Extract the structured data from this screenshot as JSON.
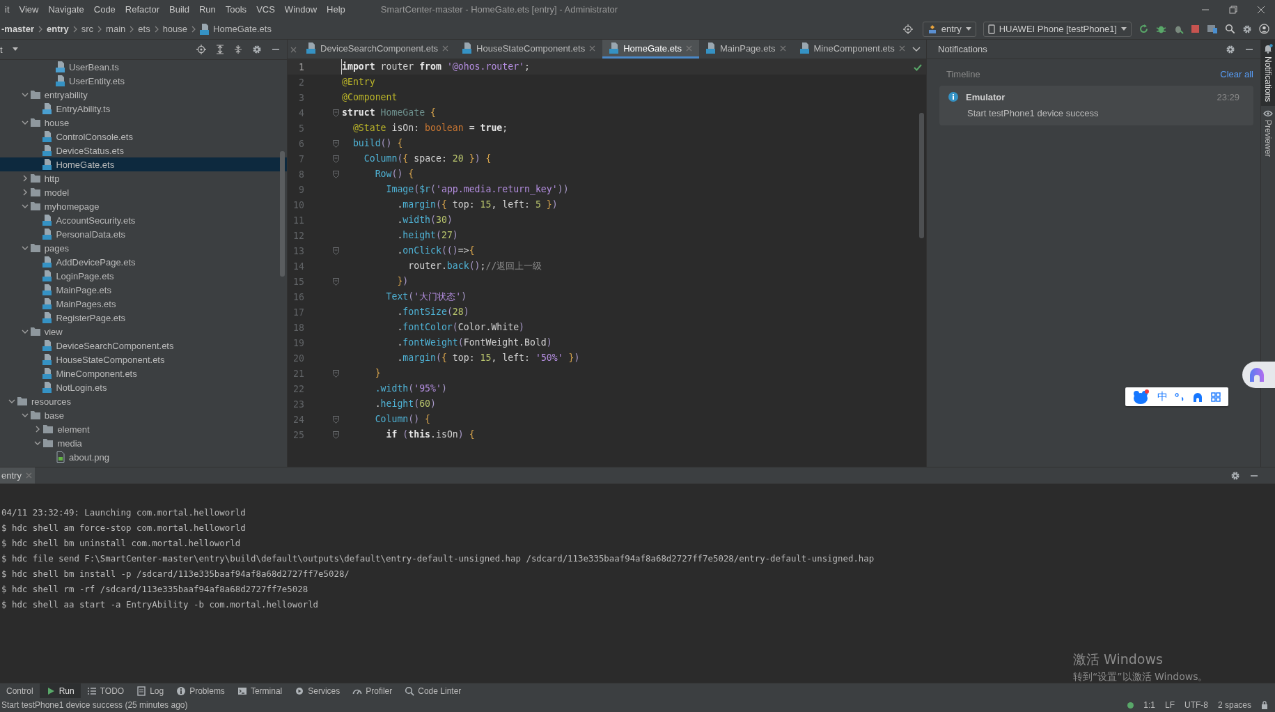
{
  "menu_bar": {
    "items": [
      "it",
      "View",
      "Navigate",
      "Code",
      "Refactor",
      "Build",
      "Run",
      "Tools",
      "VCS",
      "Window",
      "Help"
    ],
    "title": "SmartCenter-master - HomeGate.ets [entry] - Administrator"
  },
  "nav_bar": {
    "breadcrumb": [
      {
        "label": "-master",
        "bold": true
      },
      {
        "label": "entry",
        "bold": true
      },
      {
        "label": "src",
        "bold": false
      },
      {
        "label": "main",
        "bold": false
      },
      {
        "label": "ets",
        "bold": false
      },
      {
        "label": "house",
        "bold": false
      },
      {
        "label": "HomeGate.ets",
        "bold": false
      }
    ],
    "module_selector": "entry",
    "device_selector": "HUAWEI Phone [testPhone1]"
  },
  "project": {
    "header": "t",
    "tree": [
      {
        "kind": "offscreen",
        "children": [
          {
            "kind": "offscreen",
            "children": [
              {
                "kind": "offscreen",
                "children": [
                  {
                    "kind": "ts",
                    "name": "UserBean.ts",
                    "selected": false
                  },
                  {
                    "kind": "ets",
                    "name": "UserEntity.ets",
                    "selected": false
                  }
                ]
              }
            ]
          },
          {
            "kind": "folder",
            "name": "entryability",
            "expanded": true,
            "selected": false,
            "children": [
              {
                "kind": "ts",
                "name": "EntryAbility.ts",
                "selected": false
              }
            ]
          },
          {
            "kind": "folder",
            "name": "house",
            "expanded": true,
            "selected": false,
            "children": [
              {
                "kind": "ets",
                "name": "ControlConsole.ets",
                "selected": false
              },
              {
                "kind": "ets",
                "name": "DeviceStatus.ets",
                "selected": false
              },
              {
                "kind": "ets",
                "name": "HomeGate.ets",
                "selected": true
              }
            ]
          },
          {
            "kind": "folder",
            "name": "http",
            "expanded": false,
            "selected": false
          },
          {
            "kind": "folder",
            "name": "model",
            "expanded": false,
            "selected": false
          },
          {
            "kind": "folder",
            "name": "myhomepage",
            "expanded": true,
            "selected": false,
            "children": [
              {
                "kind": "ets",
                "name": "AccountSecurity.ets",
                "selected": false
              },
              {
                "kind": "ets",
                "name": "PersonalData.ets",
                "selected": false
              }
            ]
          },
          {
            "kind": "folder",
            "name": "pages",
            "expanded": true,
            "selected": false,
            "children": [
              {
                "kind": "ets",
                "name": "AddDevicePage.ets",
                "selected": false
              },
              {
                "kind": "ets",
                "name": "LoginPage.ets",
                "selected": false
              },
              {
                "kind": "ets",
                "name": "MainPage.ets",
                "selected": false
              },
              {
                "kind": "ets",
                "name": "MainPages.ets",
                "selected": false
              },
              {
                "kind": "ets",
                "name": "RegisterPage.ets",
                "selected": false
              }
            ]
          },
          {
            "kind": "folder",
            "name": "view",
            "expanded": true,
            "selected": false,
            "children": [
              {
                "kind": "ets",
                "name": "DeviceSearchComponent.ets",
                "selected": false
              },
              {
                "kind": "ets",
                "name": "HouseStateComponent.ets",
                "selected": false
              },
              {
                "kind": "ets",
                "name": "MineComponent.ets",
                "selected": false
              },
              {
                "kind": "ets",
                "name": "NotLogin.ets",
                "selected": false
              }
            ]
          }
        ]
      },
      {
        "kind": "folder",
        "name": "resources",
        "expanded": true,
        "selected": false,
        "children": [
          {
            "kind": "folder",
            "name": "base",
            "expanded": true,
            "selected": false,
            "children": [
              {
                "kind": "folder",
                "name": "element",
                "expanded": false,
                "selected": false
              },
              {
                "kind": "folder",
                "name": "media",
                "expanded": true,
                "selected": false,
                "children": [
                  {
                    "kind": "png",
                    "name": "about.png",
                    "selected": false
                  }
                ]
              }
            ]
          }
        ]
      }
    ]
  },
  "editor": {
    "tabs": [
      {
        "label": "DeviceSearchComponent.ets",
        "selected": false
      },
      {
        "label": "HouseStateComponent.ets",
        "selected": false
      },
      {
        "label": "HomeGate.ets",
        "selected": true
      },
      {
        "label": "MainPage.ets",
        "selected": false
      },
      {
        "label": "MineComponent.ets",
        "selected": false
      }
    ],
    "lines": [
      {
        "number": "1",
        "current": true,
        "fold": false,
        "tokens": [
          {
            "kind": "kw",
            "text": "import"
          },
          {
            "kind": "plain",
            "text": " router "
          },
          {
            "kind": "kw",
            "text": "from"
          },
          {
            "kind": "str",
            "text": " '@ohos.router'"
          },
          {
            "kind": "plain",
            "text": ";"
          }
        ]
      },
      {
        "number": "2",
        "current": false,
        "fold": false,
        "tokens": [
          {
            "kind": "ann",
            "text": "@Entry"
          }
        ]
      },
      {
        "number": "3",
        "current": false,
        "fold": false,
        "tokens": [
          {
            "kind": "ann",
            "text": "@Component"
          }
        ]
      },
      {
        "number": "4",
        "current": false,
        "fold": true,
        "tokens": [
          {
            "kind": "kw",
            "text": "struct"
          },
          {
            "kind": "cls",
            "text": " HomeGate"
          },
          {
            "kind": "brace",
            "text": " {"
          }
        ]
      },
      {
        "number": "5",
        "current": false,
        "fold": false,
        "tokens": [
          {
            "kind": "ann",
            "text": "  @State"
          },
          {
            "kind": "plain",
            "text": " isOn: "
          },
          {
            "kind": "type",
            "text": "boolean"
          },
          {
            "kind": "plain",
            "text": " = "
          },
          {
            "kind": "kw",
            "text": "true"
          },
          {
            "kind": "plain",
            "text": ";"
          }
        ]
      },
      {
        "number": "6",
        "current": false,
        "fold": true,
        "tokens": [
          {
            "kind": "fn",
            "text": "  build"
          },
          {
            "kind": "paren",
            "text": "()"
          },
          {
            "kind": "brace",
            "text": " {"
          }
        ]
      },
      {
        "number": "7",
        "current": false,
        "fold": true,
        "tokens": [
          {
            "kind": "fn",
            "text": "    Column"
          },
          {
            "kind": "paren",
            "text": "("
          },
          {
            "kind": "brace",
            "text": "{"
          },
          {
            "kind": "plain",
            "text": " space: "
          },
          {
            "kind": "num",
            "text": "20"
          },
          {
            "kind": "brace",
            "text": " }"
          },
          {
            "kind": "paren",
            "text": ")"
          },
          {
            "kind": "brace",
            "text": " {"
          }
        ]
      },
      {
        "number": "8",
        "current": false,
        "fold": true,
        "tokens": [
          {
            "kind": "fn",
            "text": "      Row"
          },
          {
            "kind": "paren",
            "text": "()"
          },
          {
            "kind": "brace",
            "text": " {"
          }
        ]
      },
      {
        "number": "9",
        "current": false,
        "fold": false,
        "tokens": [
          {
            "kind": "fn",
            "text": "        Image"
          },
          {
            "kind": "paren",
            "text": "("
          },
          {
            "kind": "fn",
            "text": "$r"
          },
          {
            "kind": "paren",
            "text": "("
          },
          {
            "kind": "str",
            "text": "'app.media.return_key'"
          },
          {
            "kind": "paren",
            "text": "))"
          }
        ]
      },
      {
        "number": "10",
        "current": false,
        "fold": false,
        "tokens": [
          {
            "kind": "plain",
            "text": "          ."
          },
          {
            "kind": "fn",
            "text": "margin"
          },
          {
            "kind": "paren",
            "text": "("
          },
          {
            "kind": "brace",
            "text": "{"
          },
          {
            "kind": "plain",
            "text": " top: "
          },
          {
            "kind": "num",
            "text": "15"
          },
          {
            "kind": "plain",
            "text": ", left: "
          },
          {
            "kind": "num",
            "text": "5"
          },
          {
            "kind": "brace",
            "text": " }"
          },
          {
            "kind": "paren",
            "text": ")"
          }
        ]
      },
      {
        "number": "11",
        "current": false,
        "fold": false,
        "tokens": [
          {
            "kind": "plain",
            "text": "          ."
          },
          {
            "kind": "fn",
            "text": "width"
          },
          {
            "kind": "paren",
            "text": "("
          },
          {
            "kind": "num",
            "text": "30"
          },
          {
            "kind": "paren",
            "text": ")"
          }
        ]
      },
      {
        "number": "12",
        "current": false,
        "fold": false,
        "tokens": [
          {
            "kind": "plain",
            "text": "          ."
          },
          {
            "kind": "fn",
            "text": "height"
          },
          {
            "kind": "paren",
            "text": "("
          },
          {
            "kind": "num",
            "text": "27"
          },
          {
            "kind": "paren",
            "text": ")"
          }
        ]
      },
      {
        "number": "13",
        "current": false,
        "fold": true,
        "tokens": [
          {
            "kind": "plain",
            "text": "          ."
          },
          {
            "kind": "fn",
            "text": "onClick"
          },
          {
            "kind": "paren",
            "text": "(()"
          },
          {
            "kind": "plain",
            "text": "=>"
          },
          {
            "kind": "brace",
            "text": "{"
          }
        ]
      },
      {
        "number": "14",
        "current": false,
        "fold": false,
        "tokens": [
          {
            "kind": "plain",
            "text": "            router."
          },
          {
            "kind": "fn",
            "text": "back"
          },
          {
            "kind": "paren",
            "text": "()"
          },
          {
            "kind": "plain",
            "text": ";"
          },
          {
            "kind": "comment",
            "text": "//返回上一级"
          }
        ]
      },
      {
        "number": "15",
        "current": false,
        "fold": true,
        "tokens": [
          {
            "kind": "brace",
            "text": "          }"
          },
          {
            "kind": "paren",
            "text": ")"
          }
        ]
      },
      {
        "number": "16",
        "current": false,
        "fold": false,
        "tokens": [
          {
            "kind": "fn",
            "text": "        Text"
          },
          {
            "kind": "paren",
            "text": "("
          },
          {
            "kind": "str",
            "text": "'大门状态'"
          },
          {
            "kind": "paren",
            "text": ")"
          }
        ]
      },
      {
        "number": "17",
        "current": false,
        "fold": false,
        "tokens": [
          {
            "kind": "plain",
            "text": "          ."
          },
          {
            "kind": "fn",
            "text": "fontSize"
          },
          {
            "kind": "paren",
            "text": "("
          },
          {
            "kind": "num",
            "text": "28"
          },
          {
            "kind": "paren",
            "text": ")"
          }
        ]
      },
      {
        "number": "18",
        "current": false,
        "fold": false,
        "tokens": [
          {
            "kind": "plain",
            "text": "          ."
          },
          {
            "kind": "fn",
            "text": "fontColor"
          },
          {
            "kind": "paren",
            "text": "("
          },
          {
            "kind": "plain",
            "text": "Color.White"
          },
          {
            "kind": "paren",
            "text": ")"
          }
        ]
      },
      {
        "number": "19",
        "current": false,
        "fold": false,
        "tokens": [
          {
            "kind": "plain",
            "text": "          ."
          },
          {
            "kind": "fn",
            "text": "fontWeight"
          },
          {
            "kind": "paren",
            "text": "("
          },
          {
            "kind": "plain",
            "text": "FontWeight.Bold"
          },
          {
            "kind": "paren",
            "text": ")"
          }
        ]
      },
      {
        "number": "20",
        "current": false,
        "fold": false,
        "tokens": [
          {
            "kind": "plain",
            "text": "          ."
          },
          {
            "kind": "fn",
            "text": "margin"
          },
          {
            "kind": "paren",
            "text": "("
          },
          {
            "kind": "brace",
            "text": "{"
          },
          {
            "kind": "plain",
            "text": " top: "
          },
          {
            "kind": "num",
            "text": "15"
          },
          {
            "kind": "plain",
            "text": ", left: "
          },
          {
            "kind": "str",
            "text": "'50%'"
          },
          {
            "kind": "brace",
            "text": " }"
          },
          {
            "kind": "paren",
            "text": ")"
          }
        ]
      },
      {
        "number": "21",
        "current": false,
        "fold": true,
        "tokens": [
          {
            "kind": "brace",
            "text": "      }"
          }
        ]
      },
      {
        "number": "22",
        "current": false,
        "fold": false,
        "tokens": [
          {
            "kind": "fn",
            "text": "      .width"
          },
          {
            "kind": "paren",
            "text": "("
          },
          {
            "kind": "str",
            "text": "'95%'"
          },
          {
            "kind": "paren",
            "text": ")"
          }
        ]
      },
      {
        "number": "23",
        "current": false,
        "fold": false,
        "tokens": [
          {
            "kind": "plain",
            "text": "      ."
          },
          {
            "kind": "fn",
            "text": "height"
          },
          {
            "kind": "paren",
            "text": "("
          },
          {
            "kind": "num",
            "text": "60"
          },
          {
            "kind": "paren",
            "text": ")"
          }
        ]
      },
      {
        "number": "24",
        "current": false,
        "fold": true,
        "tokens": [
          {
            "kind": "fn",
            "text": "      Column"
          },
          {
            "kind": "paren",
            "text": "()"
          },
          {
            "kind": "brace",
            "text": " {"
          }
        ]
      },
      {
        "number": "25",
        "current": false,
        "fold": true,
        "tokens": [
          {
            "kind": "kw",
            "text": "        if"
          },
          {
            "kind": "paren",
            "text": " ("
          },
          {
            "kind": "kw",
            "text": "this"
          },
          {
            "kind": "plain",
            "text": ".isOn"
          },
          {
            "kind": "paren",
            "text": ")"
          },
          {
            "kind": "brace",
            "text": " {"
          }
        ]
      }
    ]
  },
  "notifications": {
    "title": "Notifications",
    "timeline_label": "Timeline",
    "clear_all": "Clear all",
    "items": [
      {
        "source": "Emulator",
        "time": "23:29",
        "message": "Start testPhone1 device success"
      }
    ]
  },
  "side_strip": {
    "items": [
      {
        "label": "Notifications",
        "kind": "bell",
        "selected": true
      },
      {
        "label": "Previewer",
        "kind": "eye",
        "selected": false
      }
    ]
  },
  "ime_toolbar": {
    "mode": "中"
  },
  "run_panel": {
    "tab": "entry",
    "lines": [
      "04/11 23:32:49: Launching com.mortal.helloworld",
      "$ hdc shell am force-stop com.mortal.helloworld",
      "$ hdc shell bm uninstall com.mortal.helloworld",
      "$ hdc file send F:\\SmartCenter-master\\entry\\build\\default\\outputs\\default\\entry-default-unsigned.hap /sdcard/113e335baaf94af8a68d2727ff7e5028/entry-default-unsigned.hap",
      "$ hdc shell bm install -p /sdcard/113e335baaf94af8a68d2727ff7e5028/",
      "$ hdc shell rm -rf /sdcard/113e335baaf94af8a68d2727ff7e5028",
      "$ hdc shell aa start -a EntryAbility -b com.mortal.helloworld"
    ]
  },
  "tool_strip": {
    "items": [
      {
        "label": "Control",
        "kind": "none",
        "selected": false
      },
      {
        "label": "Run",
        "kind": "run",
        "selected": true
      },
      {
        "label": "TODO",
        "kind": "todo",
        "selected": false
      },
      {
        "label": "Log",
        "kind": "log",
        "selected": false
      },
      {
        "label": "Problems",
        "kind": "problems",
        "selected": false
      },
      {
        "label": "Terminal",
        "kind": "terminal",
        "selected": false
      },
      {
        "label": "Services",
        "kind": "services",
        "selected": false
      },
      {
        "label": "Profiler",
        "kind": "profiler",
        "selected": false
      },
      {
        "label": "Code Linter",
        "kind": "linter",
        "selected": false
      }
    ]
  },
  "status_bar": {
    "message": "Start testPhone1 device success (25 minutes ago)",
    "position": "1:1",
    "line_separator": "LF",
    "encoding": "UTF-8",
    "indent": "2 spaces"
  },
  "os_notice": {
    "title": "激活 Windows",
    "text": "转到“设置”以激活 Windows。"
  }
}
